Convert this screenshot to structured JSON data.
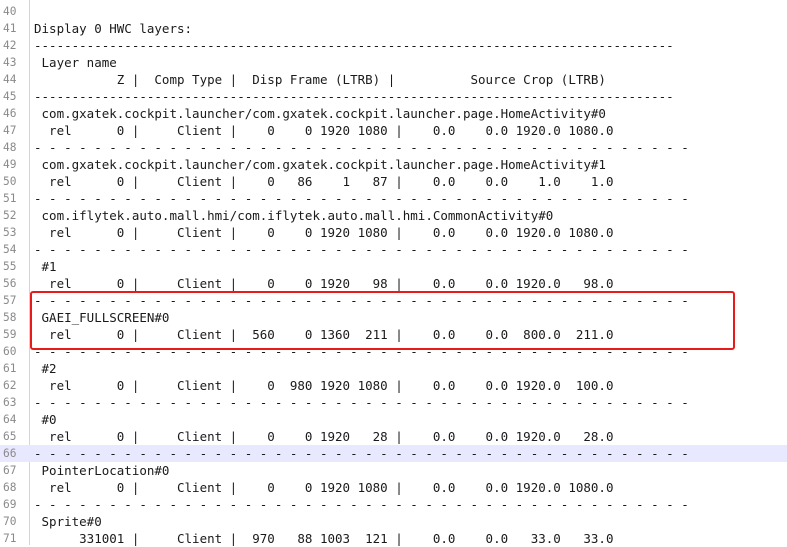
{
  "editor": {
    "lines": [
      {
        "num": "40",
        "text": ""
      },
      {
        "num": "41",
        "text": "Display 0 HWC layers:"
      },
      {
        "num": "42",
        "text": "-------------------------------------------------------------------------------------"
      },
      {
        "num": "43",
        "text": " Layer name"
      },
      {
        "num": "44",
        "text": "           Z |  Comp Type |  Disp Frame (LTRB) |          Source Crop (LTRB)"
      },
      {
        "num": "45",
        "text": "-------------------------------------------------------------------------------------"
      },
      {
        "num": "46",
        "text": " com.gxatek.cockpit.launcher/com.gxatek.cockpit.launcher.page.HomeActivity#0"
      },
      {
        "num": "47",
        "text": "  rel      0 |     Client |    0    0 1920 1080 |    0.0    0.0 1920.0 1080.0"
      },
      {
        "num": "48",
        "text": "- - - - - - - - - - - - - - - - - - - - - - - - - - - - - - - - - - - - - - - - - - - -"
      },
      {
        "num": "49",
        "text": " com.gxatek.cockpit.launcher/com.gxatek.cockpit.launcher.page.HomeActivity#1"
      },
      {
        "num": "50",
        "text": "  rel      0 |     Client |    0   86    1   87 |    0.0    0.0    1.0    1.0"
      },
      {
        "num": "51",
        "text": "- - - - - - - - - - - - - - - - - - - - - - - - - - - - - - - - - - - - - - - - - - - -"
      },
      {
        "num": "52",
        "text": " com.iflytek.auto.mall.hmi/com.iflytek.auto.mall.hmi.CommonActivity#0"
      },
      {
        "num": "53",
        "text": "  rel      0 |     Client |    0    0 1920 1080 |    0.0    0.0 1920.0 1080.0"
      },
      {
        "num": "54",
        "text": "- - - - - - - - - - - - - - - - - - - - - - - - - - - - - - - - - - - - - - - - - - - -"
      },
      {
        "num": "55",
        "text": " #1"
      },
      {
        "num": "56",
        "text": "  rel      0 |     Client |    0    0 1920   98 |    0.0    0.0 1920.0   98.0"
      },
      {
        "num": "57",
        "text": "- - - - - - - - - - - - - - - - - - - - - - - - - - - - - - - - - - - - - - - - - - - -"
      },
      {
        "num": "58",
        "text": " GAEI_FULLSCREEN#0"
      },
      {
        "num": "59",
        "text": "  rel      0 |     Client |  560    0 1360  211 |    0.0    0.0  800.0  211.0"
      },
      {
        "num": "60",
        "text": "- - - - - - - - - - - - - - - - - - - - - - - - - - - - - - - - - - - - - - - - - - - -"
      },
      {
        "num": "61",
        "text": " #2"
      },
      {
        "num": "62",
        "text": "  rel      0 |     Client |    0  980 1920 1080 |    0.0    0.0 1920.0  100.0"
      },
      {
        "num": "63",
        "text": "- - - - - - - - - - - - - - - - - - - - - - - - - - - - - - - - - - - - - - - - - - - -"
      },
      {
        "num": "64",
        "text": " #0"
      },
      {
        "num": "65",
        "text": "  rel      0 |     Client |    0    0 1920   28 |    0.0    0.0 1920.0   28.0"
      },
      {
        "num": "66",
        "text": "- - - - - - - - - - - - - - - - - - - - - - - - - - - - - - - - - - - - - - - - - - - -"
      },
      {
        "num": "67",
        "text": " PointerLocation#0"
      },
      {
        "num": "68",
        "text": "  rel      0 |     Client |    0    0 1920 1080 |    0.0    0.0 1920.0 1080.0"
      },
      {
        "num": "69",
        "text": "- - - - - - - - - - - - - - - - - - - - - - - - - - - - - - - - - - - - - - - - - - - -"
      },
      {
        "num": "70",
        "text": " Sprite#0"
      },
      {
        "num": "71",
        "text": "      331001 |     Client |  970   88 1003  121 |    0.0    0.0   33.0   33.0"
      }
    ],
    "highlighted_line": "66",
    "boxed_lines": [
      "58",
      "59"
    ],
    "colors": {
      "text": "#1a1a1a",
      "gutter_text": "#8a8a8a",
      "current_line": "#e8e8ff",
      "annotation_box": "#e81a1a"
    }
  }
}
